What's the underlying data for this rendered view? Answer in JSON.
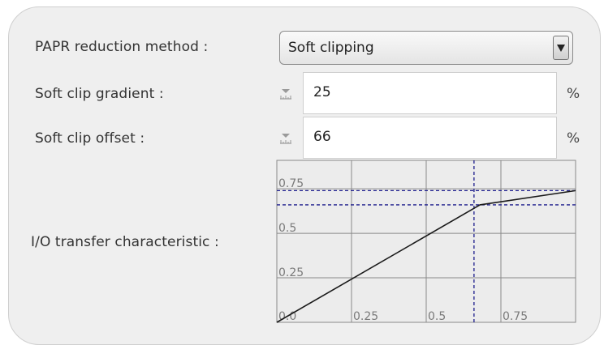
{
  "form": {
    "papr_method": {
      "label": "PAPR reduction method :",
      "value": "Soft clipping"
    },
    "gradient": {
      "label": "Soft clip gradient :",
      "value": "25",
      "unit": "%"
    },
    "offset": {
      "label": "Soft clip offset :",
      "value": "66",
      "unit": "%"
    },
    "io_label": "I/O transfer characteristic :"
  },
  "chart_data": {
    "type": "line",
    "x": [
      0.0,
      0.68,
      1.0
    ],
    "y": [
      0.0,
      0.66,
      0.74
    ],
    "xlim": [
      0.0,
      1.0
    ],
    "ylim": [
      0.0,
      0.91
    ],
    "x_ticks": [
      0.0,
      0.25,
      0.5,
      0.75
    ],
    "x_tick_labels": [
      "0.0",
      "0.25",
      "0.5",
      "0.75"
    ],
    "y_tick_labels": [
      "0.25",
      "0.5",
      "0.75"
    ],
    "y_ticks": [
      0.25,
      0.5,
      0.75
    ],
    "grid": true,
    "guide_lines": {
      "vertical_x": 0.66,
      "horizontal_y": [
        0.66,
        0.74
      ]
    },
    "colors": {
      "line": "#1a1a1a",
      "guides": "#1c1c8c",
      "grid": "#8a8a8a"
    }
  }
}
